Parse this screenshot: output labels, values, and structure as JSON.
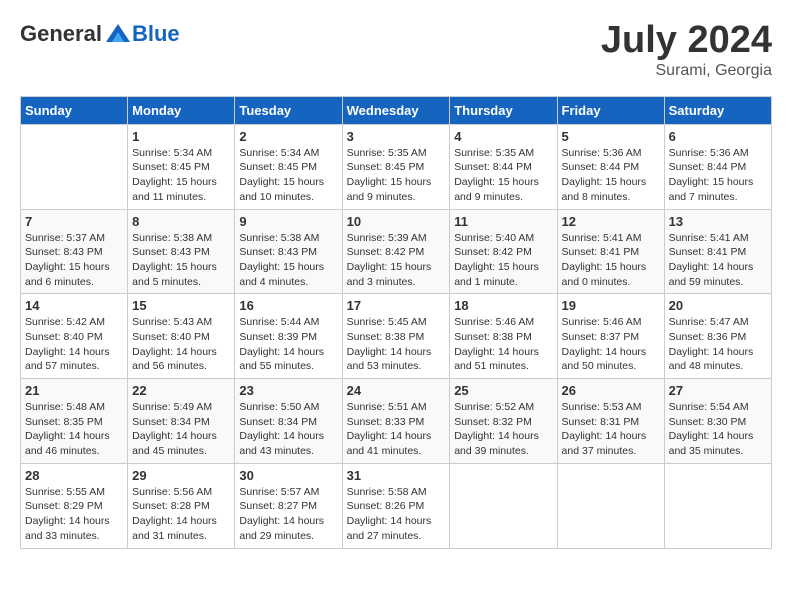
{
  "header": {
    "logo_general": "General",
    "logo_blue": "Blue",
    "month": "July 2024",
    "location": "Surami, Georgia"
  },
  "weekdays": [
    "Sunday",
    "Monday",
    "Tuesday",
    "Wednesday",
    "Thursday",
    "Friday",
    "Saturday"
  ],
  "weeks": [
    [
      {
        "day": "",
        "info": ""
      },
      {
        "day": "1",
        "info": "Sunrise: 5:34 AM\nSunset: 8:45 PM\nDaylight: 15 hours\nand 11 minutes."
      },
      {
        "day": "2",
        "info": "Sunrise: 5:34 AM\nSunset: 8:45 PM\nDaylight: 15 hours\nand 10 minutes."
      },
      {
        "day": "3",
        "info": "Sunrise: 5:35 AM\nSunset: 8:45 PM\nDaylight: 15 hours\nand 9 minutes."
      },
      {
        "day": "4",
        "info": "Sunrise: 5:35 AM\nSunset: 8:44 PM\nDaylight: 15 hours\nand 9 minutes."
      },
      {
        "day": "5",
        "info": "Sunrise: 5:36 AM\nSunset: 8:44 PM\nDaylight: 15 hours\nand 8 minutes."
      },
      {
        "day": "6",
        "info": "Sunrise: 5:36 AM\nSunset: 8:44 PM\nDaylight: 15 hours\nand 7 minutes."
      }
    ],
    [
      {
        "day": "7",
        "info": "Sunrise: 5:37 AM\nSunset: 8:43 PM\nDaylight: 15 hours\nand 6 minutes."
      },
      {
        "day": "8",
        "info": "Sunrise: 5:38 AM\nSunset: 8:43 PM\nDaylight: 15 hours\nand 5 minutes."
      },
      {
        "day": "9",
        "info": "Sunrise: 5:38 AM\nSunset: 8:43 PM\nDaylight: 15 hours\nand 4 minutes."
      },
      {
        "day": "10",
        "info": "Sunrise: 5:39 AM\nSunset: 8:42 PM\nDaylight: 15 hours\nand 3 minutes."
      },
      {
        "day": "11",
        "info": "Sunrise: 5:40 AM\nSunset: 8:42 PM\nDaylight: 15 hours\nand 1 minute."
      },
      {
        "day": "12",
        "info": "Sunrise: 5:41 AM\nSunset: 8:41 PM\nDaylight: 15 hours\nand 0 minutes."
      },
      {
        "day": "13",
        "info": "Sunrise: 5:41 AM\nSunset: 8:41 PM\nDaylight: 14 hours\nand 59 minutes."
      }
    ],
    [
      {
        "day": "14",
        "info": "Sunrise: 5:42 AM\nSunset: 8:40 PM\nDaylight: 14 hours\nand 57 minutes."
      },
      {
        "day": "15",
        "info": "Sunrise: 5:43 AM\nSunset: 8:40 PM\nDaylight: 14 hours\nand 56 minutes."
      },
      {
        "day": "16",
        "info": "Sunrise: 5:44 AM\nSunset: 8:39 PM\nDaylight: 14 hours\nand 55 minutes."
      },
      {
        "day": "17",
        "info": "Sunrise: 5:45 AM\nSunset: 8:38 PM\nDaylight: 14 hours\nand 53 minutes."
      },
      {
        "day": "18",
        "info": "Sunrise: 5:46 AM\nSunset: 8:38 PM\nDaylight: 14 hours\nand 51 minutes."
      },
      {
        "day": "19",
        "info": "Sunrise: 5:46 AM\nSunset: 8:37 PM\nDaylight: 14 hours\nand 50 minutes."
      },
      {
        "day": "20",
        "info": "Sunrise: 5:47 AM\nSunset: 8:36 PM\nDaylight: 14 hours\nand 48 minutes."
      }
    ],
    [
      {
        "day": "21",
        "info": "Sunrise: 5:48 AM\nSunset: 8:35 PM\nDaylight: 14 hours\nand 46 minutes."
      },
      {
        "day": "22",
        "info": "Sunrise: 5:49 AM\nSunset: 8:34 PM\nDaylight: 14 hours\nand 45 minutes."
      },
      {
        "day": "23",
        "info": "Sunrise: 5:50 AM\nSunset: 8:34 PM\nDaylight: 14 hours\nand 43 minutes."
      },
      {
        "day": "24",
        "info": "Sunrise: 5:51 AM\nSunset: 8:33 PM\nDaylight: 14 hours\nand 41 minutes."
      },
      {
        "day": "25",
        "info": "Sunrise: 5:52 AM\nSunset: 8:32 PM\nDaylight: 14 hours\nand 39 minutes."
      },
      {
        "day": "26",
        "info": "Sunrise: 5:53 AM\nSunset: 8:31 PM\nDaylight: 14 hours\nand 37 minutes."
      },
      {
        "day": "27",
        "info": "Sunrise: 5:54 AM\nSunset: 8:30 PM\nDaylight: 14 hours\nand 35 minutes."
      }
    ],
    [
      {
        "day": "28",
        "info": "Sunrise: 5:55 AM\nSunset: 8:29 PM\nDaylight: 14 hours\nand 33 minutes."
      },
      {
        "day": "29",
        "info": "Sunrise: 5:56 AM\nSunset: 8:28 PM\nDaylight: 14 hours\nand 31 minutes."
      },
      {
        "day": "30",
        "info": "Sunrise: 5:57 AM\nSunset: 8:27 PM\nDaylight: 14 hours\nand 29 minutes."
      },
      {
        "day": "31",
        "info": "Sunrise: 5:58 AM\nSunset: 8:26 PM\nDaylight: 14 hours\nand 27 minutes."
      },
      {
        "day": "",
        "info": ""
      },
      {
        "day": "",
        "info": ""
      },
      {
        "day": "",
        "info": ""
      }
    ]
  ]
}
